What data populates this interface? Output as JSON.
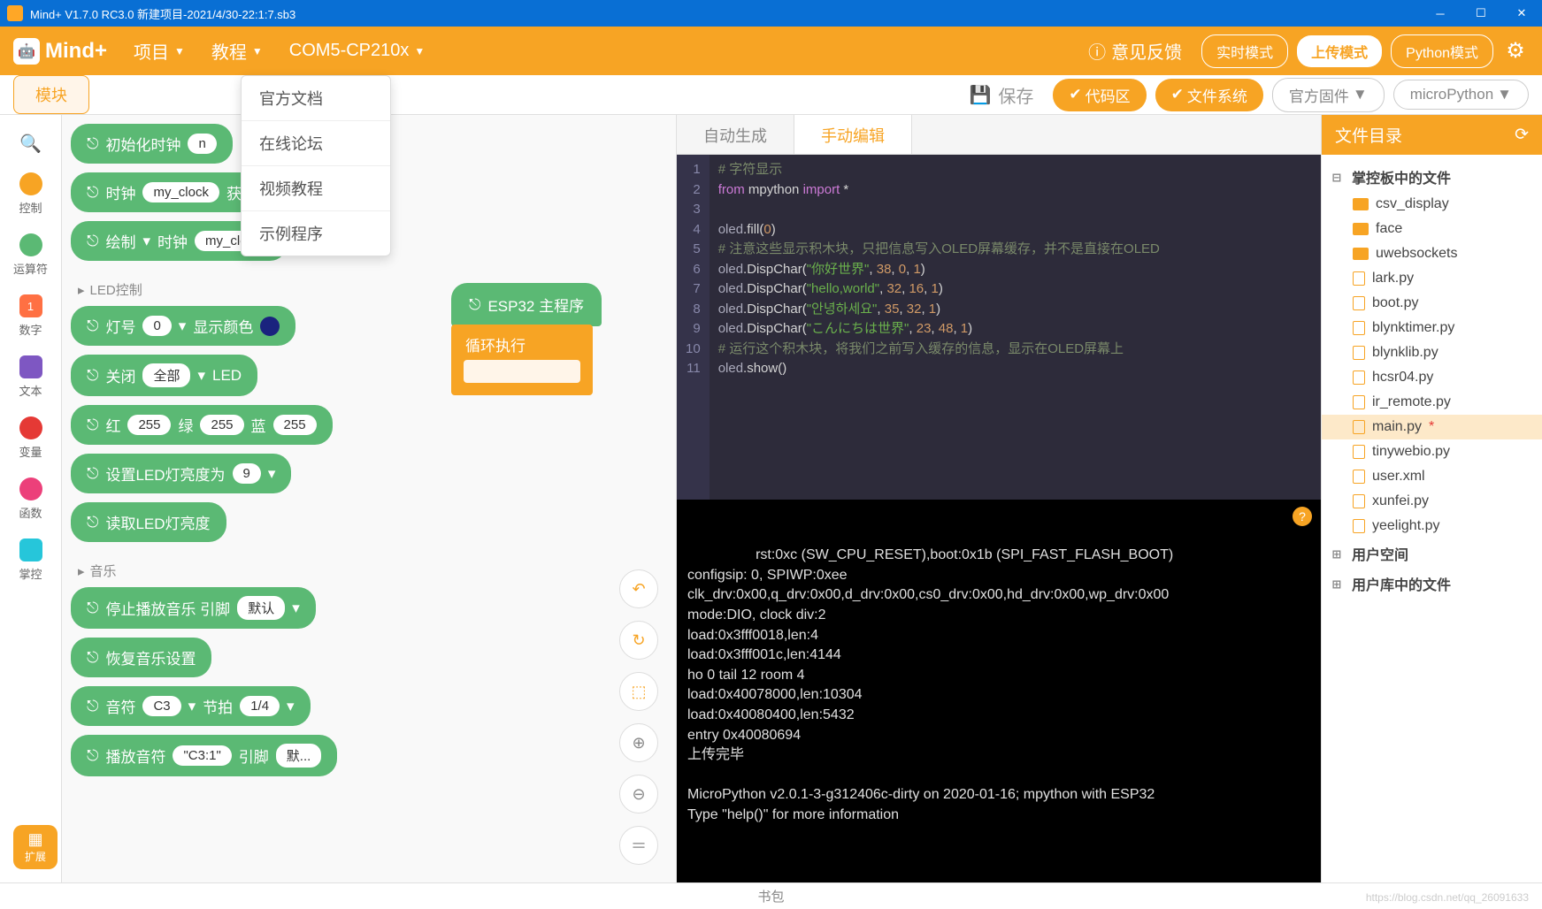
{
  "titlebar": {
    "text": "Mind+ V1.7.0 RC3.0   新建项目-2021/4/30-22:1:7.sb3"
  },
  "logo": "Mind+",
  "menu": {
    "project": "项目",
    "tutorial": "教程",
    "port": "COM5-CP210x"
  },
  "dropdown": [
    "官方文档",
    "在线论坛",
    "视频教程",
    "示例程序"
  ],
  "feedback": "意见反馈",
  "modes": {
    "realtime": "实时模式",
    "upload": "上传模式",
    "python": "Python模式"
  },
  "toolbar": {
    "blocks": "模块",
    "save": "保存",
    "code": "代码区",
    "fs": "文件系统",
    "firmware": "官方固件",
    "runtime": "microPython"
  },
  "categories": [
    {
      "name": "search",
      "label": "",
      "color": "transparent",
      "icon": "🔍"
    },
    {
      "name": "control",
      "label": "控制",
      "color": "#f7a424"
    },
    {
      "name": "operators",
      "label": "运算符",
      "color": "#5bb974"
    },
    {
      "name": "number",
      "label": "数字",
      "color": "#ff7043",
      "badge": "1"
    },
    {
      "name": "text",
      "label": "文本",
      "color": "#7e57c2"
    },
    {
      "name": "variables",
      "label": "变量",
      "color": "#e53935"
    },
    {
      "name": "functions",
      "label": "函数",
      "color": "#ec407a"
    },
    {
      "name": "board",
      "label": "掌控",
      "color": "#26c6da"
    }
  ],
  "block_sections": {
    "led": "LED控制",
    "music": "音乐"
  },
  "blocks": {
    "init_clock": "初始化时钟",
    "clock": "时钟",
    "clock_arg": "my_clock",
    "clock_suffix": "获取时间",
    "draw": "绘制",
    "draw_clock": "时钟",
    "draw_arg": "my_clock",
    "led_num": "灯号",
    "led_num_val": "0",
    "led_show": "显示颜色",
    "close": "关闭",
    "all": "全部",
    "led": "LED",
    "r": "红",
    "g": "绿",
    "b": "蓝",
    "val255": "255",
    "set_brightness": "设置LED灯亮度为",
    "brightness_val": "9",
    "read_brightness": "读取LED灯亮度",
    "stop_music": "停止播放音乐 引脚",
    "stop_pin": "默认",
    "reset_music": "恢复音乐设置",
    "note": "音符",
    "note_val": "C3",
    "beat": "节拍",
    "beat_val": "1/4",
    "play_note": "播放音符",
    "play_note_val": "\"C3:1\"",
    "play_pin": "引脚",
    "play_pin_val": "默..."
  },
  "canvas": {
    "hat": "ESP32 主程序",
    "loop": "循环执行"
  },
  "code_tabs": {
    "auto": "自动生成",
    "manual": "手动编辑"
  },
  "code": [
    {
      "n": 1,
      "t": "comment",
      "s": "# 字符显示"
    },
    {
      "n": 2,
      "t": "import",
      "s": "from mpython import *"
    },
    {
      "n": 3,
      "t": "blank",
      "s": ""
    },
    {
      "n": 4,
      "t": "call",
      "s": "oled.fill(0)"
    },
    {
      "n": 5,
      "t": "comment",
      "s": "# 注意这些显示积木块，只把信息写入OLED屏幕缓存，并不是直接在OLED"
    },
    {
      "n": 6,
      "t": "call",
      "s": "oled.DispChar(\"你好世界\", 38, 0, 1)"
    },
    {
      "n": 7,
      "t": "call",
      "s": "oled.DispChar(\"hello,world\", 32, 16, 1)"
    },
    {
      "n": 8,
      "t": "call",
      "s": "oled.DispChar(\"안녕하세요\", 35, 32, 1)"
    },
    {
      "n": 9,
      "t": "call",
      "s": "oled.DispChar(\"こんにちは世界\", 23, 48, 1)"
    },
    {
      "n": 10,
      "t": "comment",
      "s": "# 运行这个积木块，将我们之前写入缓存的信息，显示在OLED屏幕上"
    },
    {
      "n": 11,
      "t": "call",
      "s": "oled.show()"
    }
  ],
  "terminal": "rst:0xc (SW_CPU_RESET),boot:0x1b (SPI_FAST_FLASH_BOOT)\nconfigsip: 0, SPIWP:0xee\nclk_drv:0x00,q_drv:0x00,d_drv:0x00,cs0_drv:0x00,hd_drv:0x00,wp_drv:0x00\nmode:DIO, clock div:2\nload:0x3fff0018,len:4\nload:0x3fff001c,len:4144\nho 0 tail 12 room 4\nload:0x40078000,len:10304\nload:0x40080400,len:5432\nentry 0x40080694\n上传完毕\n\nMicroPython v2.0.1-3-g312406c-dirty on 2020-01-16; mpython with ESP32\nType \"help()\" for more information",
  "file_panel": {
    "title": "文件目录"
  },
  "file_tree": {
    "root": "掌控板中的文件",
    "folders": [
      "csv_display",
      "face",
      "uwebsockets"
    ],
    "files": [
      "lark.py",
      "boot.py",
      "blynktimer.py",
      "blynklib.py",
      "hcsr04.py",
      "ir_remote.py",
      "main.py",
      "tinywebio.py",
      "user.xml",
      "xunfei.py",
      "yeelight.py"
    ],
    "selected": "main.py",
    "user_space": "用户空间",
    "user_lib": "用户库中的文件"
  },
  "footer": "书包",
  "ext": "扩展",
  "watermark": "https://blog.csdn.net/qq_26091633"
}
